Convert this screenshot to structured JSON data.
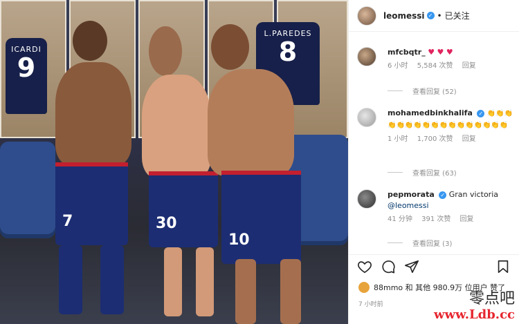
{
  "post": {
    "header": {
      "username": "leomessi",
      "separator": "•",
      "follow_label": "已关注"
    },
    "photo": {
      "jerseys": [
        {
          "name": "ICARDI",
          "number": "9"
        },
        {
          "name": "L.PAREDES",
          "number": "8"
        }
      ],
      "players": [
        {
          "short_number": "7"
        },
        {
          "short_number": "30"
        },
        {
          "short_number": "10"
        }
      ]
    },
    "comments": [
      {
        "username": "mfcbqtr_",
        "verified": false,
        "text": "",
        "hearts": "♥ ♥ ♥",
        "time": "6 小时",
        "likes": "5,584 次赞",
        "reply_label": "回复",
        "view_replies": "查看回复 (52)"
      },
      {
        "username": "mohamedbinkhalifa",
        "verified": true,
        "text": "👏👏👏👏👏👏👏👏👏👏👏👏👏👏👏👏👏",
        "hearts": "",
        "time": "1 小时",
        "likes": "1,700 次赞",
        "reply_label": "回复",
        "view_replies": "查看回复 (63)"
      },
      {
        "username": "pepmorata",
        "verified": true,
        "text": "Gran victoria",
        "mention": "@leomessi",
        "hearts": "",
        "time": "41 分钟",
        "likes": "391 次赞",
        "reply_label": "回复",
        "view_replies": "查看回复 (3)"
      }
    ],
    "likes_text": "88mmo 和 其他 980.9万 位用户 赞了",
    "posted_time": "7 小时前"
  },
  "watermark": {
    "cn": "零点吧",
    "url": "www.Ldb.cc"
  },
  "colors": {
    "verified": "#3897f0",
    "heart": "#e0245e",
    "watermark": "#e6262f",
    "psg_navy": "#1c2d73",
    "psg_red": "#c21f2f"
  },
  "icons": [
    "heart-icon",
    "comment-icon",
    "share-icon",
    "bookmark-icon"
  ]
}
